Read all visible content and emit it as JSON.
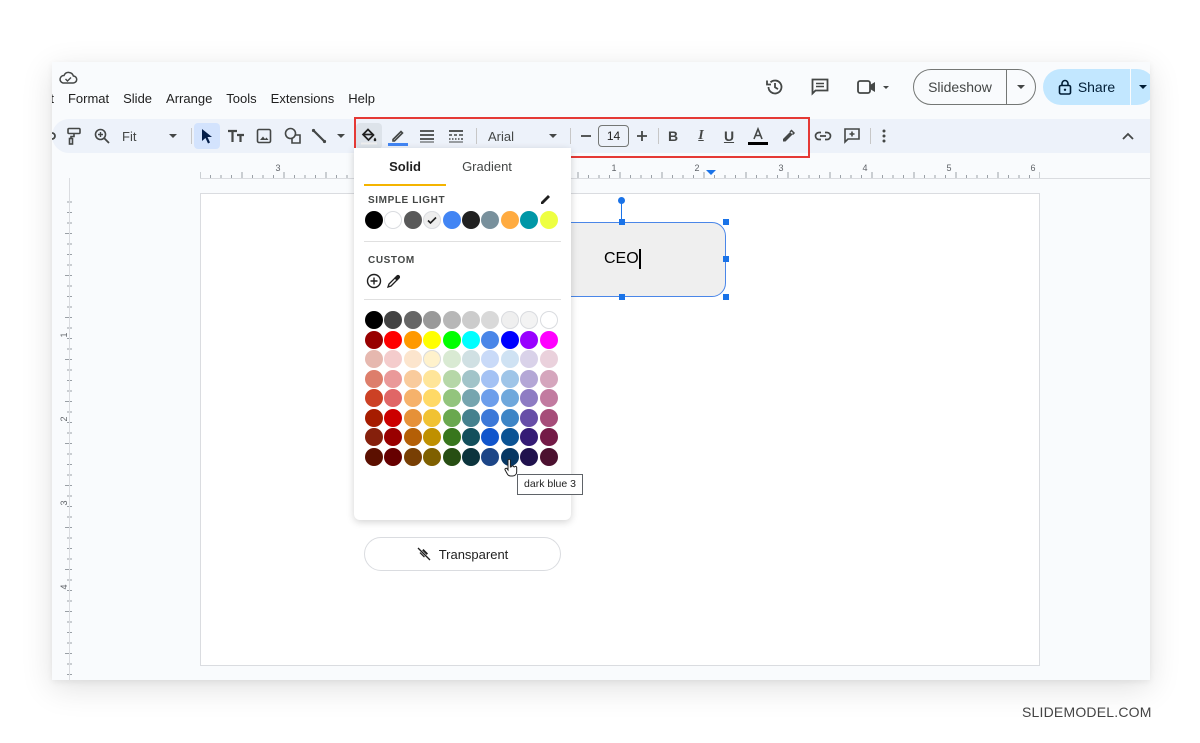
{
  "menu": [
    "rt",
    "Format",
    "Slide",
    "Arrange",
    "Tools",
    "Extensions",
    "Help"
  ],
  "header": {
    "slideshow_label": "Slideshow",
    "share_label": "Share",
    "icons": [
      "cloud-saved-icon",
      "history-icon",
      "comment-icon",
      "meet-camera-icon"
    ]
  },
  "toolbar": {
    "zoom_label": "Fit",
    "font_name": "Arial",
    "font_size": "14",
    "underline_color": "#4285f4",
    "text_color": "#000000"
  },
  "ruler": {
    "horizontal": [
      "3",
      "1",
      "2",
      "3",
      "4",
      "5",
      "6"
    ],
    "vertical": [
      "1",
      "2",
      "3",
      "4"
    ]
  },
  "slide": {
    "shape_text": "CEO",
    "shape_fill": "#efefef",
    "selection_color": "#1a73e8"
  },
  "fill_popup": {
    "tabs": [
      "Solid",
      "Gradient"
    ],
    "active_tab": "Solid",
    "theme_label": "SIMPLE LIGHT",
    "custom_label": "CUSTOM",
    "transparent_label": "Transparent",
    "theme_colors": [
      "#000000",
      "#ffffff",
      "#595959",
      "#eeeeee",
      "#4285f4",
      "#212121",
      "#78909c",
      "#ffab40",
      "#0097a7",
      "#eeff41"
    ],
    "selected_theme_index": 3,
    "palette": [
      [
        "#000000",
        "#434343",
        "#666666",
        "#999999",
        "#b7b7b7",
        "#cccccc",
        "#d9d9d9",
        "#efefef",
        "#f3f3f3",
        "#ffffff"
      ],
      [
        "#980000",
        "#ff0000",
        "#ff9900",
        "#ffff00",
        "#00ff00",
        "#00ffff",
        "#4a86e8",
        "#0000ff",
        "#9900ff",
        "#ff00ff"
      ],
      [
        "#e6b8af",
        "#f4cccc",
        "#fce5cd",
        "#fff2cc",
        "#d9ead3",
        "#d0e0e3",
        "#c9daf8",
        "#cfe2f3",
        "#d9d2e9",
        "#ead1dc"
      ],
      [
        "#dd7e6b",
        "#ea9999",
        "#f9cb9c",
        "#ffe599",
        "#b6d7a8",
        "#a2c4c9",
        "#a4c2f4",
        "#9fc5e8",
        "#b4a7d6",
        "#d5a6bd"
      ],
      [
        "#cc4125",
        "#e06666",
        "#f6b26b",
        "#ffd966",
        "#93c47d",
        "#76a5af",
        "#6d9eeb",
        "#6fa8dc",
        "#8e7cc3",
        "#c27ba0"
      ],
      [
        "#a61c00",
        "#cc0000",
        "#e69138",
        "#f1c232",
        "#6aa84f",
        "#45818e",
        "#3c78d8",
        "#3d85c6",
        "#674ea7",
        "#a64d79"
      ],
      [
        "#85200c",
        "#990000",
        "#b45f06",
        "#bf9000",
        "#38761d",
        "#134f5c",
        "#1155cc",
        "#0b5394",
        "#351c75",
        "#741b47"
      ],
      [
        "#5b0f00",
        "#660000",
        "#783f04",
        "#7f6000",
        "#274e13",
        "#0c343d",
        "#1c4587",
        "#073763",
        "#20124d",
        "#4c1130"
      ]
    ],
    "hover_tooltip": "dark blue 3"
  },
  "highlight_box_color": "#e53935",
  "watermark": "SLIDEMODEL.COM"
}
